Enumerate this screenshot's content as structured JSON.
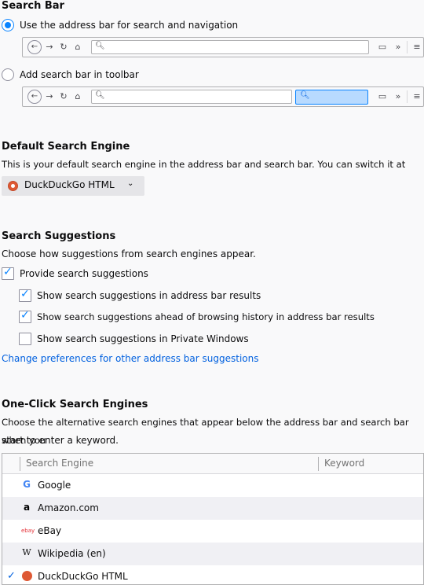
{
  "search_bar": {
    "heading": "Search Bar",
    "option_address": "Use the address bar for search and navigation",
    "option_toolbar": "Add search bar in toolbar"
  },
  "default_engine": {
    "heading": "Default Search Engine",
    "description": "This is your default search engine in the address bar and search bar. You can switch it at any time.",
    "selected": "DuckDuckGo HTML"
  },
  "suggestions": {
    "heading": "Search Suggestions",
    "description": "Choose how suggestions from search engines appear.",
    "provide_label": "Provide search suggestions",
    "provide_checked": true,
    "address_bar_label": "Show search suggestions in address bar results",
    "address_bar_checked": true,
    "ahead_label": "Show search suggestions ahead of browsing history in address bar results",
    "ahead_checked": true,
    "private_label": "Show search suggestions in Private Windows",
    "private_checked": false,
    "prefs_link": "Change preferences for other address bar suggestions"
  },
  "one_click": {
    "heading": "One-Click Search Engines",
    "description_line1": "Choose the alternative search engines that appear below the address bar and search bar when you",
    "description_line2": "start to enter a keyword.",
    "col_engine": "Search Engine",
    "col_keyword": "Keyword",
    "engines": [
      {
        "name": "Google",
        "icon": "google-icon",
        "checked": false
      },
      {
        "name": "Amazon.com",
        "icon": "amazon-icon",
        "checked": false
      },
      {
        "name": "eBay",
        "icon": "ebay-icon",
        "checked": false
      },
      {
        "name": "Wikipedia (en)",
        "icon": "wikipedia-icon",
        "checked": false
      },
      {
        "name": "DuckDuckGo HTML",
        "icon": "duckduckgo-icon",
        "checked": true
      }
    ]
  },
  "colors": {
    "accent": "#0a84ff",
    "link": "#0060df",
    "background": "#f9f9fa"
  }
}
